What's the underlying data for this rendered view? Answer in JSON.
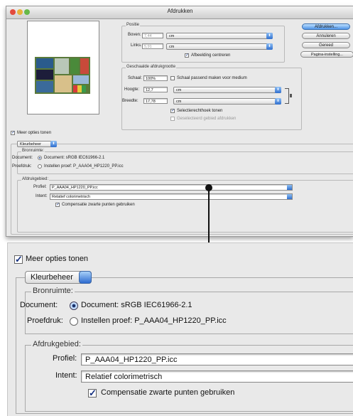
{
  "dialog": {
    "title": "Afdrukken",
    "buttons": {
      "print": "Afdrukken...",
      "cancel": "Annuleren",
      "done": "Gereed",
      "page_setup": "Pagina-instelling..."
    },
    "position": {
      "group_label": "Positie",
      "top_label": "Boven:",
      "top_value": "7,44",
      "left_label": "Links:",
      "left_value": "5,91",
      "unit": "cm",
      "center_label": "Afbeelding centreren",
      "center_checked": true
    },
    "scaled_size": {
      "group_label": "Geschaalde afdrukgrootte",
      "scale_label": "Schaal:",
      "scale_value": "100%",
      "fit_label": "Schaal passend maken voor medium",
      "height_label": "Hoogte:",
      "height_value": "12,7",
      "width_label": "Breedte:",
      "width_value": "17,78",
      "unit": "cm",
      "show_bbox_label": "Selectierechthoek tonen",
      "print_selected_label": "Geselecteerd gebied afdrukken"
    },
    "more_options_label": "Meer opties tonen",
    "color_management": {
      "select_value": "Kleurbeheer",
      "source_group_label": "Bronruimte:",
      "document_label": "Document:",
      "document_option": "Document:  sRGB IEC61966-2.1",
      "proof_label": "Proefdruk:",
      "proof_option": "Instellen proef:  P_AAA04_HP1220_PP.icc",
      "print_space_label": "Afdrukgebied:",
      "profile_label": "Profiel:",
      "profile_value": "P_AAA04_HP1220_PP.icc",
      "intent_label": "Intent:",
      "intent_value": "Relatief colorimetrisch",
      "bpc_label": "Compensatie zwarte punten gebruiken",
      "bpc_checked": true
    }
  },
  "zoom": {
    "more_options_label": "Meer opties tonen",
    "select_value": "Kleurbeheer",
    "source_group_label": "Bronruimte:",
    "document_label": "Document:",
    "document_option": "Document:  sRGB IEC61966-2.1",
    "proof_label": "Proefdruk:",
    "proof_option": "Instellen proef:  P_AAA04_HP1220_PP.icc",
    "print_space_label": "Afdrukgebied:",
    "profile_label": "Profiel:",
    "profile_value": "P_AAA04_HP1220_PP.icc",
    "intent_label": "Intent:",
    "intent_value": "Relatief colorimetrisch",
    "bpc_label": "Compensatie zwarte punten gebruiken"
  },
  "icons": {
    "checkmark": "✓",
    "popup_arrows": "⬍",
    "link": "link-bracket-icon"
  },
  "colors": {
    "accent": "#2f6fcf",
    "dialog_bg": "#e9e9e9"
  }
}
